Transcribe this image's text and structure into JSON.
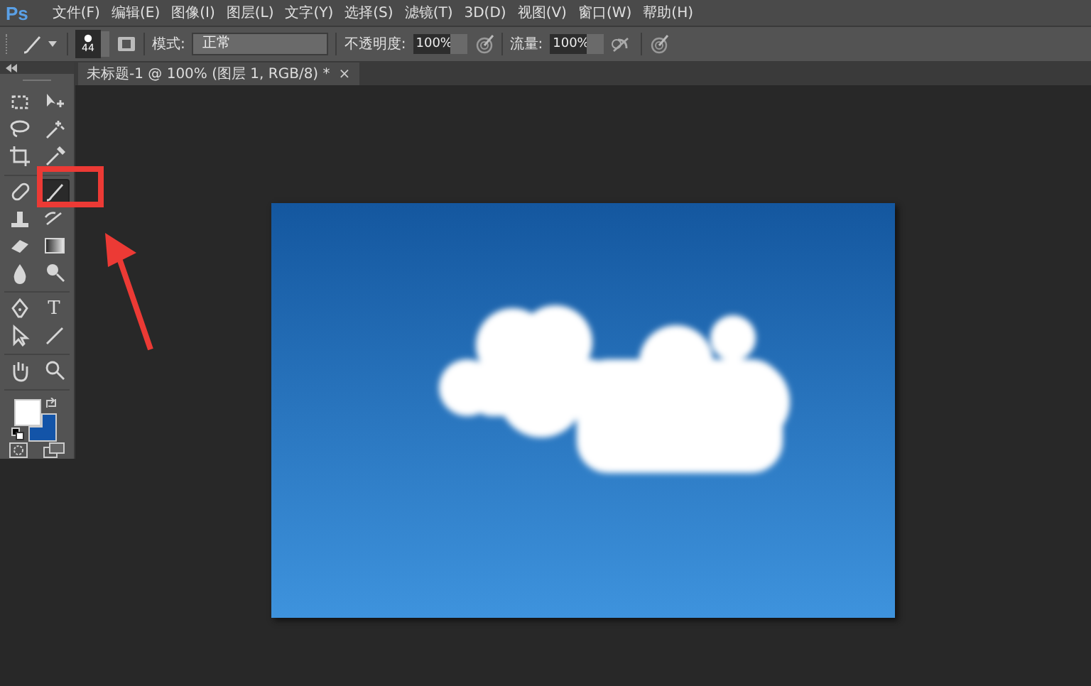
{
  "app": {
    "logo": "Ps"
  },
  "menu": [
    "文件(F)",
    "编辑(E)",
    "图像(I)",
    "图层(L)",
    "文字(Y)",
    "选择(S)",
    "滤镜(T)",
    "3D(D)",
    "视图(V)",
    "窗口(W)",
    "帮助(H)"
  ],
  "options_bar": {
    "brush_size": "44",
    "mode_label": "模式:",
    "mode_value": "正常",
    "opacity_label": "不透明度:",
    "opacity_value": "100%",
    "flow_label": "流量:",
    "flow_value": "100%"
  },
  "document_tab": {
    "title": "未标题-1 @ 100% (图层 1, RGB/8) *",
    "close": "×"
  },
  "tool_groups": [
    [
      {
        "kind": "marquee",
        "selected": false
      },
      {
        "kind": "move",
        "selected": false
      },
      {
        "kind": "lasso",
        "selected": false
      },
      {
        "kind": "wand",
        "selected": false
      },
      {
        "kind": "crop",
        "selected": false
      },
      {
        "kind": "eyedropper",
        "selected": false
      }
    ],
    [
      {
        "kind": "heal",
        "selected": false
      },
      {
        "kind": "brush",
        "selected": true
      },
      {
        "kind": "stamp",
        "selected": false
      },
      {
        "kind": "history",
        "selected": false
      },
      {
        "kind": "eraser",
        "selected": false
      },
      {
        "kind": "gradient",
        "selected": false
      },
      {
        "kind": "blur",
        "selected": false
      },
      {
        "kind": "dodge",
        "selected": false
      }
    ],
    [
      {
        "kind": "pen",
        "selected": false
      },
      {
        "kind": "type",
        "label": "T",
        "selected": false
      },
      {
        "kind": "select",
        "selected": false
      },
      {
        "kind": "line",
        "selected": false
      }
    ],
    [
      {
        "kind": "hand",
        "selected": false
      },
      {
        "kind": "zoom",
        "selected": false
      }
    ]
  ],
  "colors": [
    {
      "kind": "foreground",
      "color": "#ffffff"
    },
    {
      "kind": "background",
      "color": "#1354a8"
    }
  ]
}
